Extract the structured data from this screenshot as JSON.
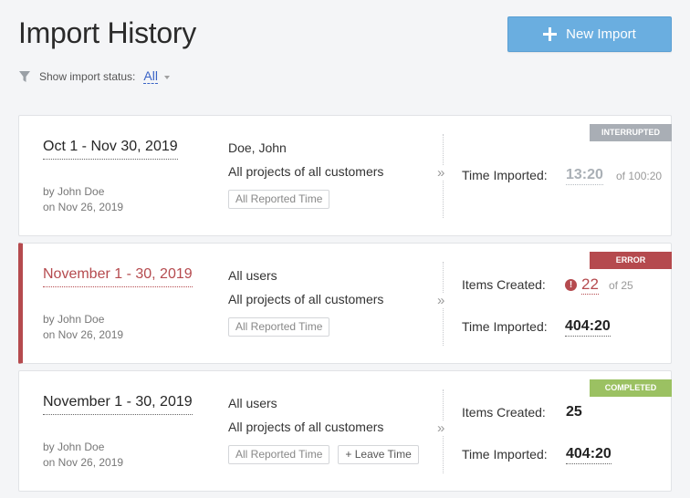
{
  "header": {
    "title": "Import History",
    "new_import_label": "New Import"
  },
  "filter": {
    "label": "Show import status:",
    "value": "All"
  },
  "imports": [
    {
      "status": "INTERRUPTED",
      "date_range": "Oct 1 - Nov 30, 2019",
      "by": "by John Doe",
      "on": "on Nov 26, 2019",
      "user": "Doe, John",
      "projects": "All projects of all customers",
      "tags": [
        "All Reported Time"
      ],
      "time_imported_label": "Time Imported:",
      "time_imported": "13:20",
      "time_total": "of 100:20"
    },
    {
      "status": "ERROR",
      "date_range": "November 1 - 30, 2019",
      "by": "by John Doe",
      "on": "on Nov 26, 2019",
      "user": "All users",
      "projects": "All projects of all customers",
      "tags": [
        "All Reported Time"
      ],
      "items_created_label": "Items Created:",
      "items_created": "22",
      "items_total": "of 25",
      "time_imported_label": "Time Imported:",
      "time_imported": "404:20"
    },
    {
      "status": "COMPLETED",
      "date_range": "November 1 - 30, 2019",
      "by": "by John Doe",
      "on": "on Nov 26, 2019",
      "user": "All users",
      "projects": "All projects of all customers",
      "tags": [
        "All Reported Time",
        "+ Leave Time"
      ],
      "items_created_label": "Items Created:",
      "items_created": "25",
      "time_imported_label": "Time Imported:",
      "time_imported": "404:20"
    }
  ],
  "colors": {
    "primary_button": "#6aaee0",
    "error": "#b54a4e",
    "interrupted": "#a9aeb5",
    "completed": "#9bc162",
    "link": "#3a63c6"
  },
  "icons": {
    "new_import": "plus-icon",
    "filter": "funnel-icon",
    "filter_dropdown": "caret-down-icon",
    "separator": "double-chevron-right-icon",
    "error_alert": "alert-circle-icon"
  }
}
